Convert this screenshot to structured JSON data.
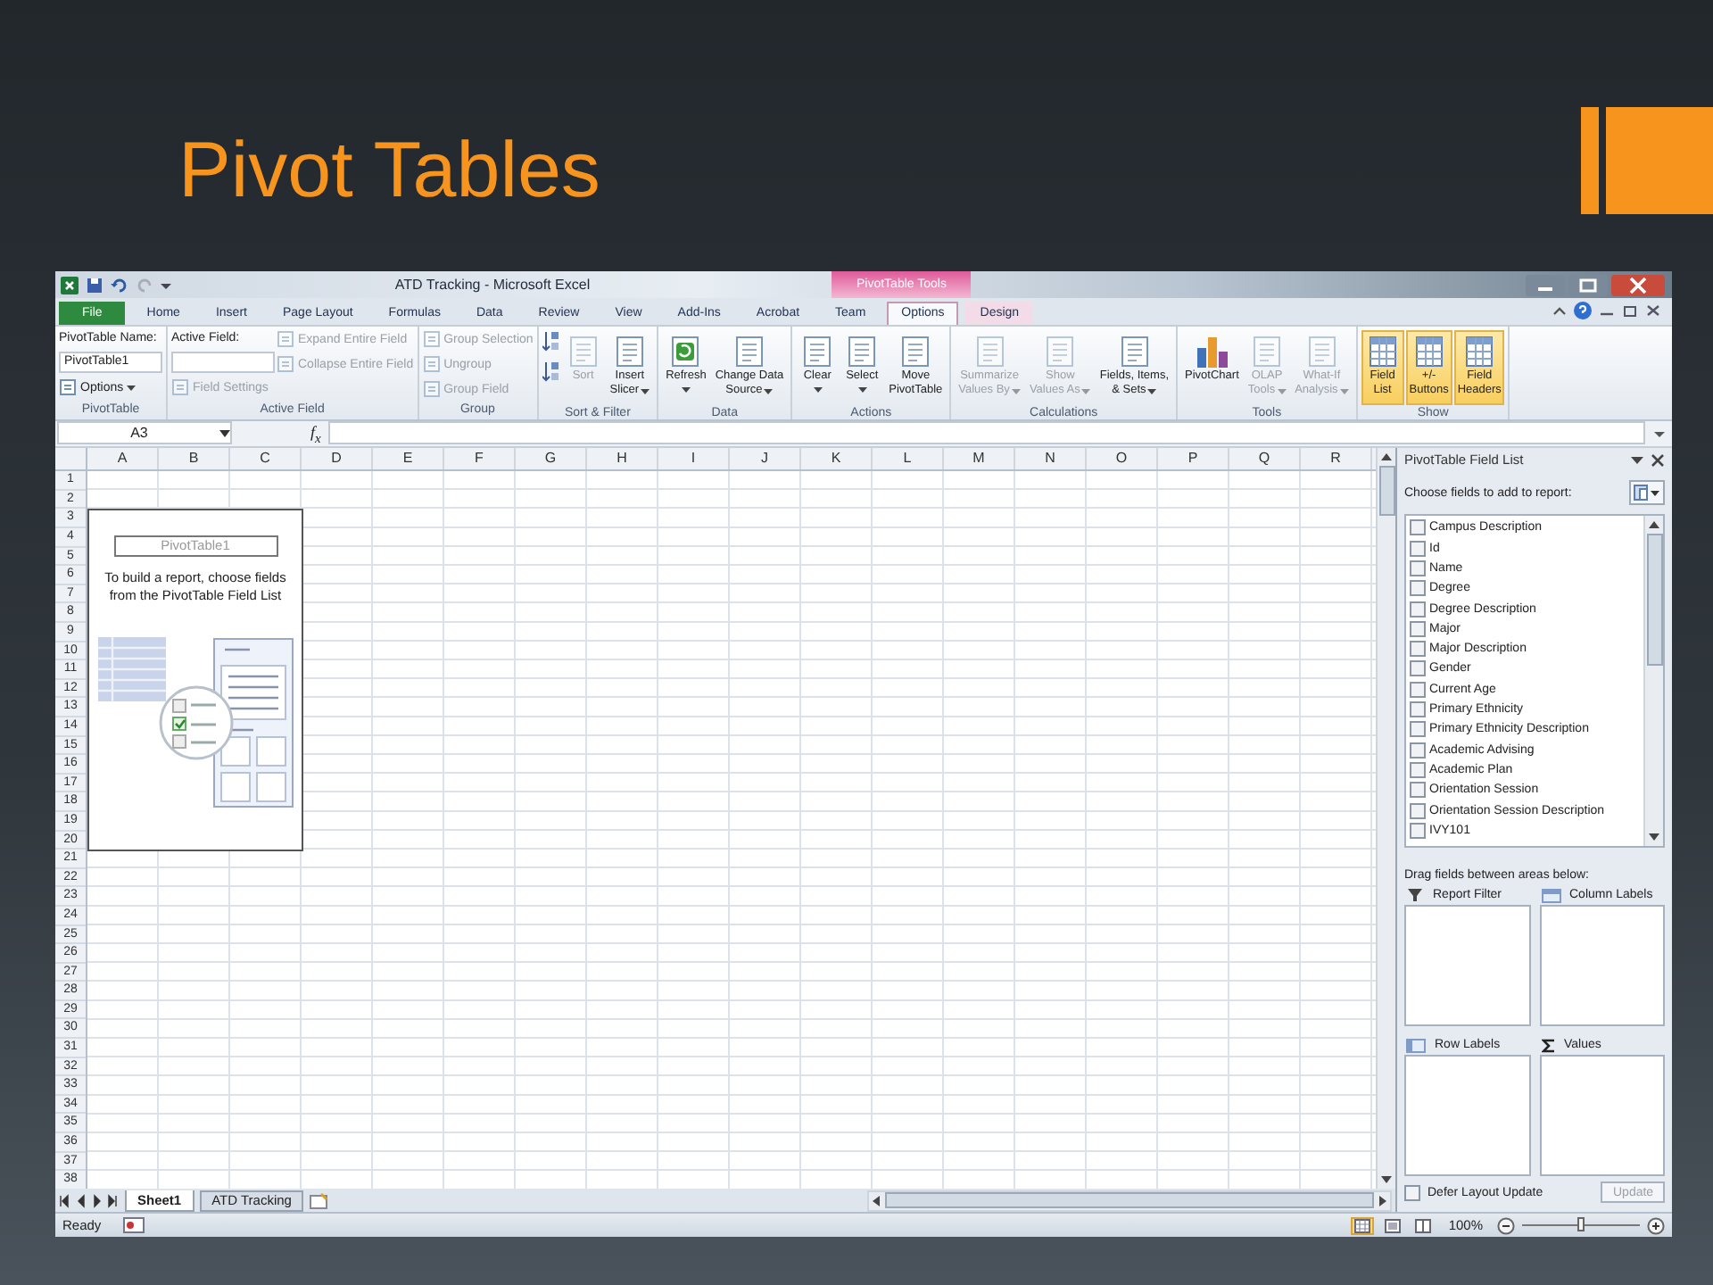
{
  "slide": {
    "title": "Pivot Tables"
  },
  "window": {
    "title": "ATD Tracking - Microsoft Excel",
    "context_label": "PivotTable Tools"
  },
  "tabs": [
    {
      "label": "File",
      "kind": "file",
      "selected": false
    },
    {
      "label": "Home",
      "kind": "tab",
      "selected": false
    },
    {
      "label": "Insert",
      "kind": "tab",
      "selected": false
    },
    {
      "label": "Page Layout",
      "kind": "tab",
      "selected": false
    },
    {
      "label": "Formulas",
      "kind": "tab",
      "selected": false
    },
    {
      "label": "Data",
      "kind": "tab",
      "selected": false
    },
    {
      "label": "Review",
      "kind": "tab",
      "selected": false
    },
    {
      "label": "View",
      "kind": "tab",
      "selected": false
    },
    {
      "label": "Add-Ins",
      "kind": "tab",
      "selected": false
    },
    {
      "label": "Acrobat",
      "kind": "tab",
      "selected": false
    },
    {
      "label": "Team",
      "kind": "tab",
      "selected": false
    },
    {
      "label": "Options",
      "kind": "context",
      "selected": true
    },
    {
      "label": "Design",
      "kind": "context",
      "selected": false
    }
  ],
  "ribbon": [
    {
      "label": "PivotTable",
      "columns": [
        [
          {
            "kind": "label",
            "text": "PivotTable Name:"
          },
          {
            "kind": "input",
            "value": "PivotTable1"
          },
          {
            "kind": "small",
            "text": "Options",
            "dropdown": true,
            "disabled": false
          }
        ]
      ]
    },
    {
      "label": "Active Field",
      "columns": [
        [
          {
            "kind": "label",
            "text": "Active Field:"
          },
          {
            "kind": "input"
          },
          {
            "kind": "small",
            "text": "Field Settings",
            "dropdown": false,
            "disabled": true
          }
        ],
        [
          {
            "kind": "small",
            "text": "Expand Entire Field",
            "dropdown": false,
            "disabled": true
          },
          {
            "kind": "small",
            "text": "Collapse Entire Field",
            "dropdown": false,
            "disabled": true
          }
        ]
      ]
    },
    {
      "label": "Group",
      "columns": [
        [
          {
            "kind": "small",
            "text": "Group Selection",
            "dropdown": false,
            "disabled": true
          },
          {
            "kind": "small",
            "text": "Ungroup",
            "dropdown": false,
            "disabled": true
          },
          {
            "kind": "small",
            "text": "Group Field",
            "dropdown": false,
            "disabled": true
          }
        ]
      ]
    },
    {
      "label": "Sort & Filter",
      "columns": [
        [
          {
            "kind": "icon",
            "disabled": false
          },
          {
            "kind": "icon",
            "disabled": false
          }
        ],
        [
          {
            "kind": "large",
            "lines": [
              "Sort"
            ],
            "dropdown": false,
            "disabled": true
          }
        ],
        [
          {
            "kind": "large",
            "lines": [
              "Insert",
              "Slicer"
            ],
            "dropdown": true,
            "disabled": false
          }
        ]
      ]
    },
    {
      "label": "Data",
      "columns": [
        [
          {
            "kind": "large",
            "lines": [
              "Refresh"
            ],
            "dropdown": true,
            "disabled": false
          }
        ],
        [
          {
            "kind": "large",
            "lines": [
              "Change Data",
              "Source"
            ],
            "dropdown": true,
            "disabled": false
          }
        ]
      ]
    },
    {
      "label": "Actions",
      "columns": [
        [
          {
            "kind": "large",
            "lines": [
              "Clear"
            ],
            "dropdown": true,
            "disabled": false
          }
        ],
        [
          {
            "kind": "large",
            "lines": [
              "Select"
            ],
            "dropdown": true,
            "disabled": false
          }
        ],
        [
          {
            "kind": "large",
            "lines": [
              "Move",
              "PivotTable"
            ],
            "dropdown": false,
            "disabled": false
          }
        ]
      ]
    },
    {
      "label": "Calculations",
      "columns": [
        [
          {
            "kind": "large",
            "lines": [
              "Summarize",
              "Values By"
            ],
            "dropdown": true,
            "disabled": true
          }
        ],
        [
          {
            "kind": "large",
            "lines": [
              "Show",
              "Values As"
            ],
            "dropdown": true,
            "disabled": true
          }
        ],
        [
          {
            "kind": "large",
            "lines": [
              "Fields, Items,",
              "& Sets"
            ],
            "dropdown": true,
            "disabled": false
          }
        ]
      ]
    },
    {
      "label": "Tools",
      "columns": [
        [
          {
            "kind": "large",
            "lines": [
              "PivotChart"
            ],
            "dropdown": false,
            "disabled": false
          }
        ],
        [
          {
            "kind": "large",
            "lines": [
              "OLAP",
              "Tools"
            ],
            "dropdown": true,
            "disabled": true
          }
        ],
        [
          {
            "kind": "large",
            "lines": [
              "What-If",
              "Analysis"
            ],
            "dropdown": true,
            "disabled": true
          }
        ]
      ]
    },
    {
      "label": "Show",
      "columns": [
        [
          {
            "kind": "large",
            "lines": [
              "Field",
              "List"
            ],
            "dropdown": false,
            "disabled": false,
            "on": true
          }
        ],
        [
          {
            "kind": "large",
            "lines": [
              "+/-",
              "Buttons"
            ],
            "dropdown": false,
            "disabled": false,
            "on": true
          }
        ],
        [
          {
            "kind": "large",
            "lines": [
              "Field",
              "Headers"
            ],
            "dropdown": false,
            "disabled": false,
            "on": true
          }
        ]
      ]
    }
  ],
  "formula_bar": {
    "name_box": "A3",
    "function_label": "f$_{x}$"
  },
  "sheet": {
    "columns": [
      "A",
      "B",
      "C",
      "D",
      "E",
      "F",
      "G",
      "H",
      "I",
      "J",
      "K",
      "L",
      "M",
      "N",
      "O",
      "P",
      "Q",
      "R"
    ],
    "rows": [
      "1",
      "2",
      "3",
      "4",
      "5",
      "6",
      "7",
      "8",
      "9",
      "10",
      "11",
      "12",
      "13",
      "14",
      "15",
      "16",
      "17",
      "18",
      "19",
      "20",
      "21",
      "22",
      "23",
      "24",
      "25",
      "26",
      "27",
      "28",
      "29",
      "30",
      "31",
      "32",
      "33",
      "34",
      "35",
      "36",
      "37",
      "38"
    ]
  },
  "pivot_placeholder": {
    "name": "PivotTable1",
    "message": "To build a report, choose fields from the PivotTable Field List"
  },
  "field_list": {
    "title": "PivotTable Field List",
    "choose_label": "Choose fields to add to report:",
    "fields": [
      {
        "name": "Campus Description",
        "checked": false
      },
      {
        "name": "Id",
        "checked": false
      },
      {
        "name": "Name",
        "checked": false
      },
      {
        "name": "Degree",
        "checked": false
      },
      {
        "name": "Degree Description",
        "checked": false
      },
      {
        "name": "Major",
        "checked": false
      },
      {
        "name": "Major Description",
        "checked": false
      },
      {
        "name": "Gender",
        "checked": false
      },
      {
        "name": "Current Age",
        "checked": false
      },
      {
        "name": "Primary Ethnicity",
        "checked": false
      },
      {
        "name": "Primary Ethnicity Description",
        "checked": false
      },
      {
        "name": "Academic Advising",
        "checked": false
      },
      {
        "name": "Academic Plan",
        "checked": false
      },
      {
        "name": "Orientation Session",
        "checked": false
      },
      {
        "name": "Orientation Session Description",
        "checked": false
      },
      {
        "name": "IVY101",
        "checked": false
      }
    ],
    "drag_label": "Drag fields between areas below:",
    "areas": [
      {
        "label": "Report Filter",
        "kind": "filter"
      },
      {
        "label": "Column Labels",
        "kind": "columns"
      },
      {
        "label": "Row Labels",
        "kind": "rows"
      },
      {
        "label": "Values",
        "kind": "values"
      }
    ],
    "defer": {
      "label": "Defer Layout Update",
      "checked": false
    },
    "update_button": {
      "label": "Update",
      "disabled": true
    }
  },
  "sheet_tabs": [
    {
      "label": "Sheet1",
      "selected": true
    },
    {
      "label": "ATD Tracking",
      "selected": false
    }
  ],
  "status_bar": {
    "text": "Ready",
    "views": [
      {
        "selected": true
      },
      {
        "selected": false
      },
      {
        "selected": false
      }
    ],
    "zoom": {
      "reading": "100%",
      "level": 0.5
    }
  }
}
